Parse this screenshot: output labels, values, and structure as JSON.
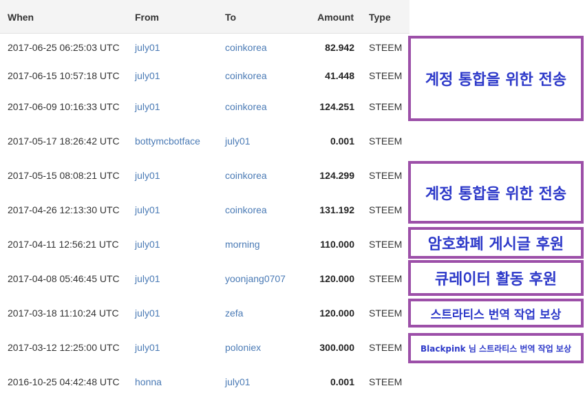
{
  "columns": {
    "when": "When",
    "from": "From",
    "to": "To",
    "amount": "Amount",
    "type": "Type"
  },
  "rows": [
    {
      "when": "2017-06-25 06:25:03 UTC",
      "from": "july01",
      "to": "coinkorea",
      "amount": "82.942",
      "type": "STEEM"
    },
    {
      "when": "2017-06-15 10:57:18 UTC",
      "from": "july01",
      "to": "coinkorea",
      "amount": "41.448",
      "type": "STEEM"
    },
    {
      "when": "2017-06-09 10:16:33 UTC",
      "from": "july01",
      "to": "coinkorea",
      "amount": "124.251",
      "type": "STEEM"
    },
    {
      "when": "2017-05-17 18:26:42 UTC",
      "from": "bottymcbotface",
      "to": "july01",
      "amount": "0.001",
      "type": "STEEM"
    },
    {
      "when": "2017-05-15 08:08:21 UTC",
      "from": "july01",
      "to": "coinkorea",
      "amount": "124.299",
      "type": "STEEM"
    },
    {
      "when": "2017-04-26 12:13:30 UTC",
      "from": "july01",
      "to": "coinkorea",
      "amount": "131.192",
      "type": "STEEM"
    },
    {
      "when": "2017-04-11 12:56:21 UTC",
      "from": "july01",
      "to": "morning",
      "amount": "110.000",
      "type": "STEEM"
    },
    {
      "when": "2017-04-08 05:46:45 UTC",
      "from": "july01",
      "to": "yoonjang0707",
      "amount": "120.000",
      "type": "STEEM"
    },
    {
      "when": "2017-03-18 11:10:24 UTC",
      "from": "july01",
      "to": "zefa",
      "amount": "120.000",
      "type": "STEEM"
    },
    {
      "when": "2017-03-12 12:25:00 UTC",
      "from": "july01",
      "to": "poloniex",
      "amount": "300.000",
      "type": "STEEM"
    },
    {
      "when": "2016-10-25 04:42:48 UTC",
      "from": "honna",
      "to": "july01",
      "amount": "0.001",
      "type": "STEEM"
    }
  ],
  "annotations": [
    "계정 통합을 위한 전송",
    "계정 통합을 위한 전송",
    "암호화폐 게시글 후원",
    "큐레이터 활동 후원",
    "스트라티스 번역 작업 보상",
    "Blackpink 님 스트라티스 번역 작업 보상"
  ],
  "colors": {
    "link": "#4a7ab5",
    "annotation_border": "#9c4fa8",
    "annotation_text": "#2d39c9"
  }
}
